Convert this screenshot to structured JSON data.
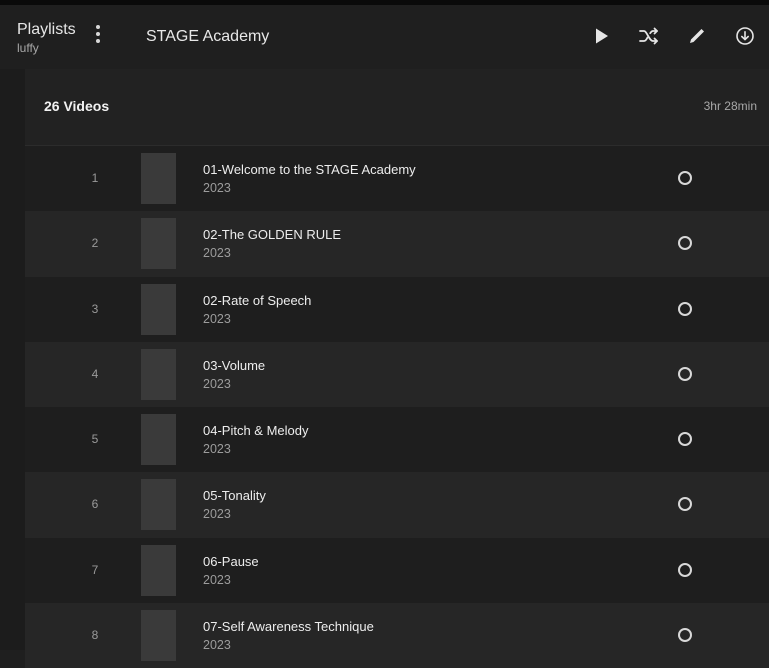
{
  "header": {
    "section_title": "Playlists",
    "user": "luffy",
    "page_title": "STAGE Academy",
    "more_icon": "kebab-vertical-icon",
    "actions": [
      {
        "name": "play",
        "icon": "play-icon"
      },
      {
        "name": "shuffle",
        "icon": "shuffle-icon"
      },
      {
        "name": "edit",
        "icon": "pencil-icon"
      },
      {
        "name": "download",
        "icon": "download-circle-icon"
      }
    ]
  },
  "summary": {
    "count_label": "26 Videos",
    "duration": "3hr 28min"
  },
  "videos": [
    {
      "index": "1",
      "title": "01-Welcome to the STAGE Academy",
      "year": "2023"
    },
    {
      "index": "2",
      "title": "02-The GOLDEN RULE",
      "year": "2023"
    },
    {
      "index": "3",
      "title": "02-Rate of Speech",
      "year": "2023"
    },
    {
      "index": "4",
      "title": "03-Volume",
      "year": "2023"
    },
    {
      "index": "5",
      "title": "04-Pitch & Melody",
      "year": "2023"
    },
    {
      "index": "6",
      "title": "05-Tonality",
      "year": "2023"
    },
    {
      "index": "7",
      "title": "06-Pause",
      "year": "2023"
    },
    {
      "index": "8",
      "title": "07-Self Awareness Technique",
      "year": "2023"
    }
  ],
  "colors": {
    "background": "#1f1f1f",
    "row_dark": "#1e1e1e",
    "row_light": "#262626",
    "thumbnail": "#3a3a3a",
    "text_primary": "#ededed",
    "text_secondary": "#9c9c9c"
  }
}
